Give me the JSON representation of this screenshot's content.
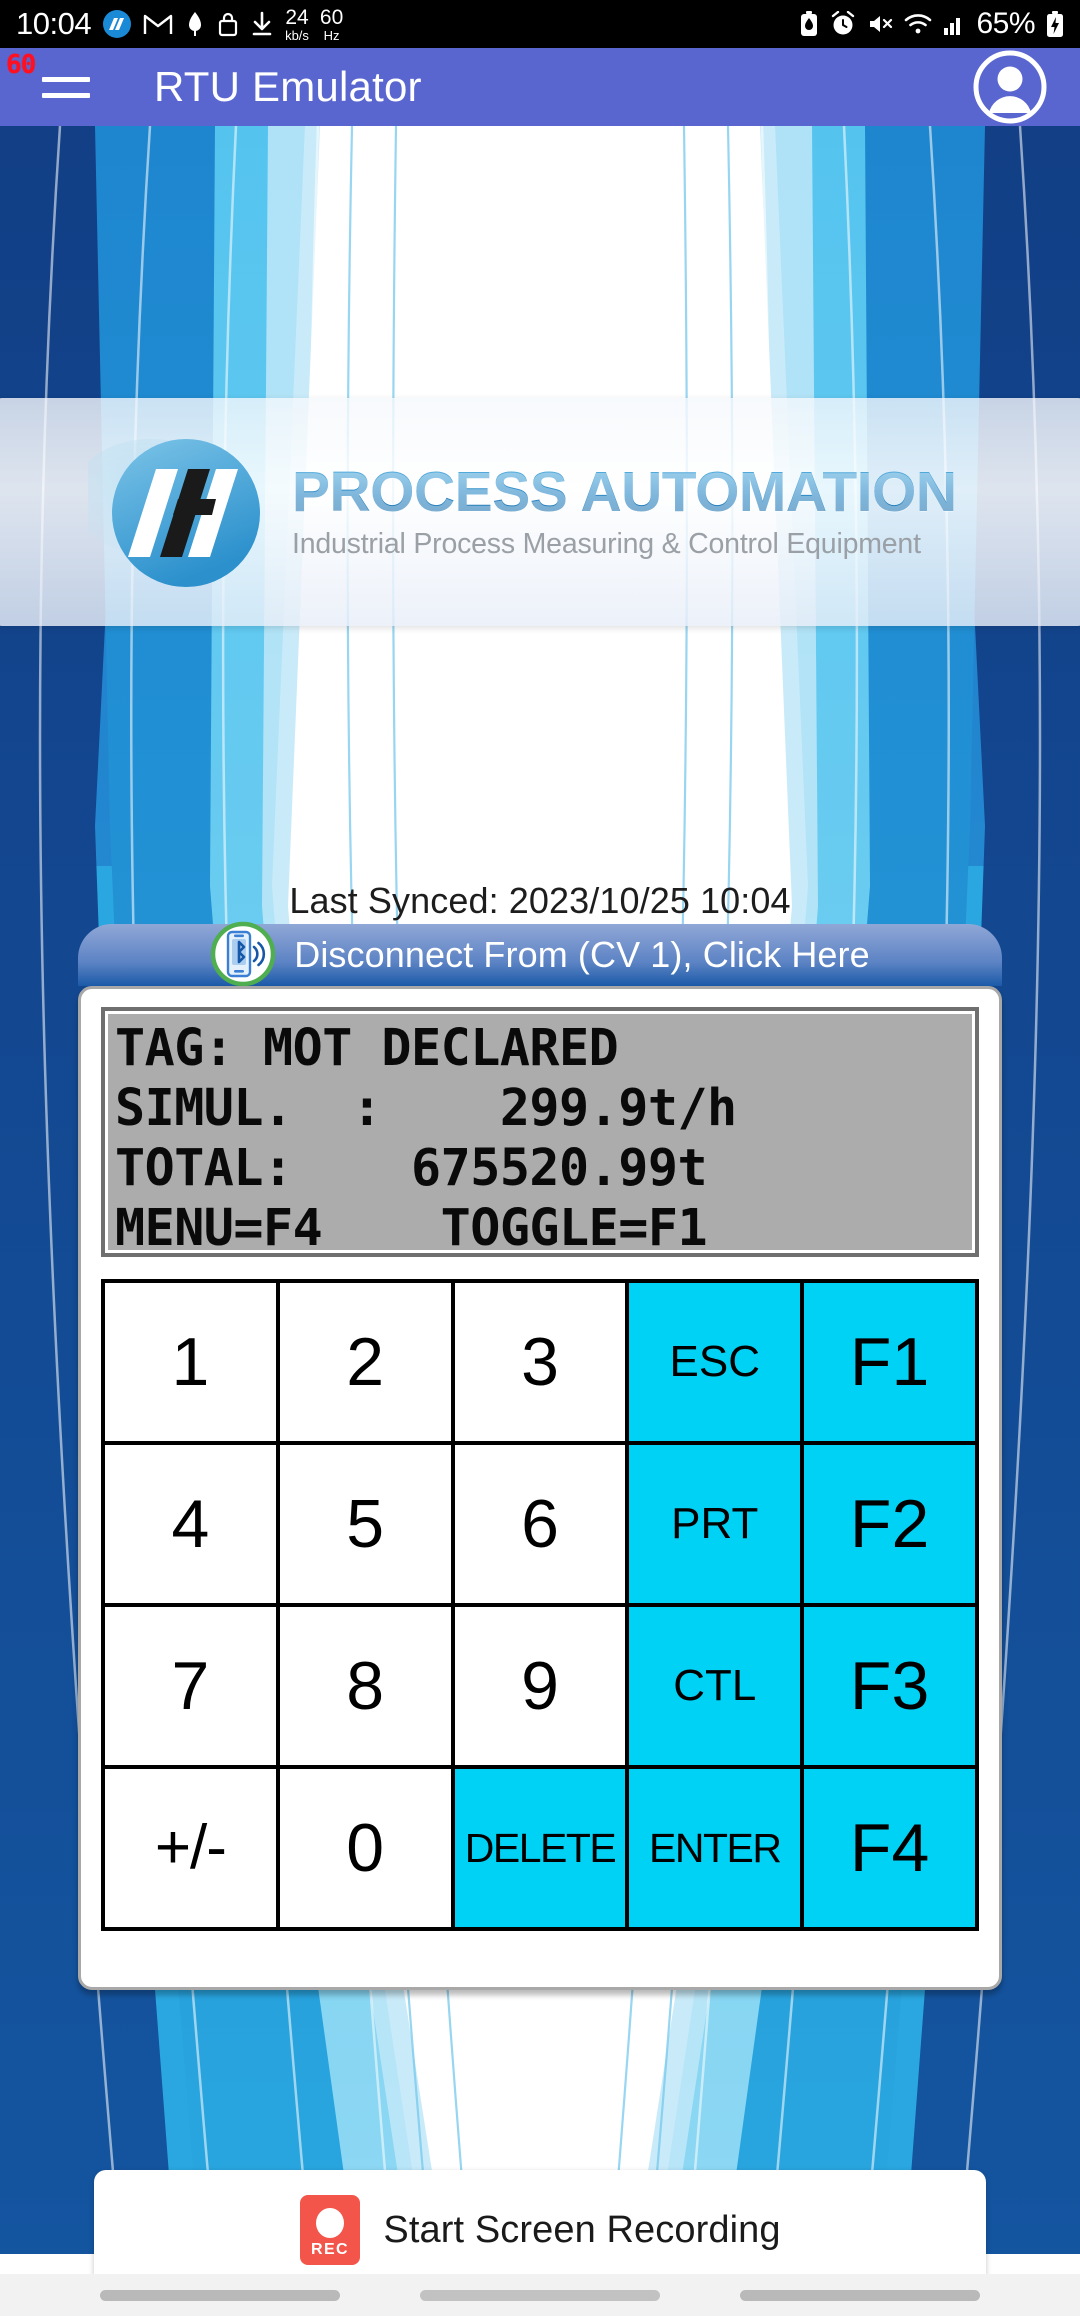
{
  "statusbar": {
    "clock": "10:04",
    "network_speed_value": "24",
    "network_speed_unit": "kb/s",
    "refresh_rate_value": "60",
    "refresh_rate_unit": "Hz",
    "battery_percent": "65%",
    "icons_left": [
      "pa-app-icon",
      "gmail-icon",
      "download-manager-icon",
      "lock-icon",
      "download-arrow-icon"
    ],
    "icons_right": [
      "battery-saver-icon",
      "alarm-icon",
      "mute-icon",
      "wifi-icon",
      "signal-icon",
      "battery-charging-icon"
    ]
  },
  "appbar": {
    "title": "RTU Emulator",
    "fps_badge": "60",
    "menu_icon": "hamburger-icon",
    "avatar_icon": "account-avatar-icon"
  },
  "logo": {
    "title": "PROCESS AUTOMATION",
    "subtitle": "Industrial Process Measuring & Control Equipment",
    "mark_text": "PA"
  },
  "sync": {
    "label": "Last Synced: 2023/10/25 10:04"
  },
  "connect": {
    "label": "Disconnect From (CV 1), Click Here",
    "icon": "bluetooth-phone-icon"
  },
  "lcd": {
    "lines": [
      "TAG: MOT DECLARED",
      "SIMUL.  :    299.9t/h",
      "TOTAL:    675520.99t",
      "MENU=F4    TOGGLE=F1"
    ]
  },
  "keypad": {
    "keys": [
      {
        "label": "1",
        "type": "num"
      },
      {
        "label": "2",
        "type": "num"
      },
      {
        "label": "3",
        "type": "num"
      },
      {
        "label": "ESC",
        "type": "fn-sm"
      },
      {
        "label": "F1",
        "type": "fn"
      },
      {
        "label": "4",
        "type": "num"
      },
      {
        "label": "5",
        "type": "num"
      },
      {
        "label": "6",
        "type": "num"
      },
      {
        "label": "PRT",
        "type": "fn-sm"
      },
      {
        "label": "F2",
        "type": "fn"
      },
      {
        "label": "7",
        "type": "num"
      },
      {
        "label": "8",
        "type": "num"
      },
      {
        "label": "9",
        "type": "num"
      },
      {
        "label": "CTL",
        "type": "fn-sm"
      },
      {
        "label": "F3",
        "type": "fn"
      },
      {
        "label": "+/-",
        "type": "num-pm"
      },
      {
        "label": "0",
        "type": "num"
      },
      {
        "label": "DELETE",
        "type": "fn-xs"
      },
      {
        "label": "ENTER",
        "type": "fn-xs"
      },
      {
        "label": "F4",
        "type": "fn"
      }
    ]
  },
  "recording": {
    "label": "Start Screen Recording",
    "icon": "rec-icon",
    "icon_text": "REC"
  },
  "colors": {
    "appbar": "#5a66cf",
    "statusbar": "#000000",
    "bg_blue": "#2aa7e0",
    "bg_dark_blue": "#1455a0",
    "fn_key": "#00d2f5",
    "lcd_bg": "#acacac",
    "fps_badge": "#ff1020",
    "rec_red": "#f4554a",
    "connect_green": "#4fae4f"
  }
}
